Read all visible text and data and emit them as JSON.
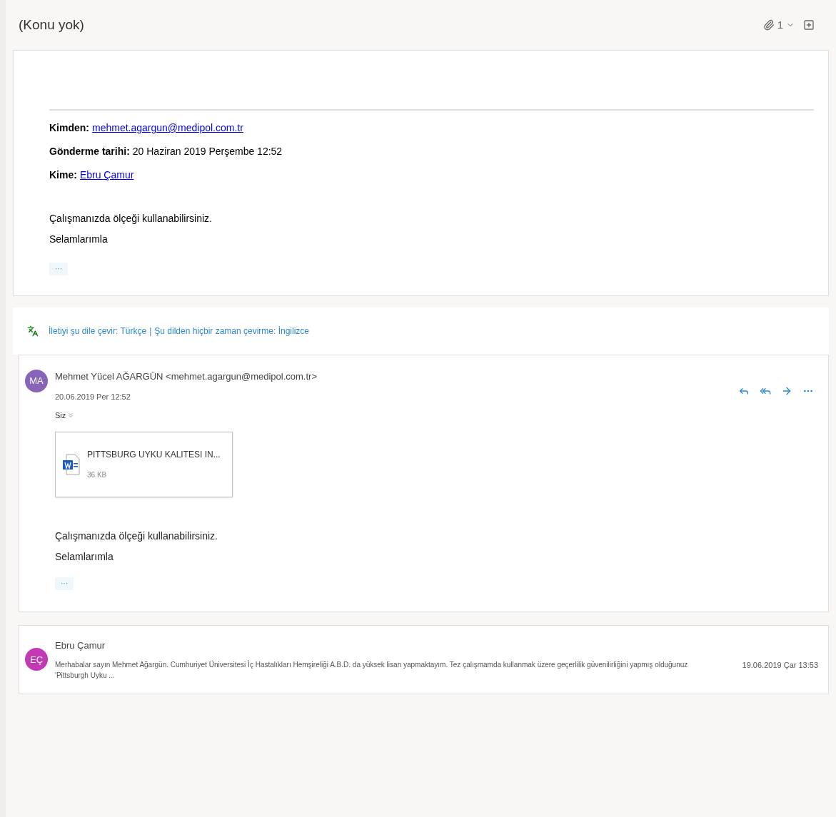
{
  "subject": "(Konu yok)",
  "header": {
    "attachment_count": "1"
  },
  "quoted": {
    "from_label": "Kimden:",
    "from": "mehmet.agargun@medipol.com.tr",
    "date_label": "Gönderme tarihi:",
    "date": "20 Haziran 2019 Perşembe 12:52",
    "to_label": "Kime:",
    "to": "Ebru Çamur",
    "body": [
      "Çalışmanızda ölçeği kullanabilirsiniz.",
      "Selamlarımla"
    ],
    "more": "···"
  },
  "translate": {
    "translate_link": "İletiyi şu dile çevir: Türkçe",
    "separator": "|",
    "never_link": "Şu dilden hiçbir zaman çevirme: İngilizce"
  },
  "messages": [
    {
      "kind": "expanded",
      "initials": "MA",
      "color": "#8764b8",
      "sender": "Mehmet Yücel AĞARGÜN <mehmet.agargun@medipol.com.tr>",
      "date": "20.06.2019 Per 12:52",
      "to": "Siz",
      "attachment": {
        "name": "PITTSBURG UYKU KALITESI IN...",
        "size": "36 KB"
      },
      "body": [
        "Çalışmanızda ölçeği kullanabilirsiniz.",
        "Selamlarımla"
      ],
      "more": "···"
    },
    {
      "kind": "collapsed",
      "initials": "EÇ",
      "color": "#c239b3",
      "sender": "Ebru Çamur",
      "preview": "Merhabalar sayın Mehmet Ağargün. Cumhuriyet Üniversitesi İç Hastalıkları Hemşireliği A.B.D. da yüksek lisan yapmaktayım. Tez çalışmamda kullanmak üzere geçerlilik güvenilirliğini yapmış olduğunuz 'Pittsburgh Uyku ...",
      "date": "19.06.2019 Çar 13:53"
    }
  ]
}
